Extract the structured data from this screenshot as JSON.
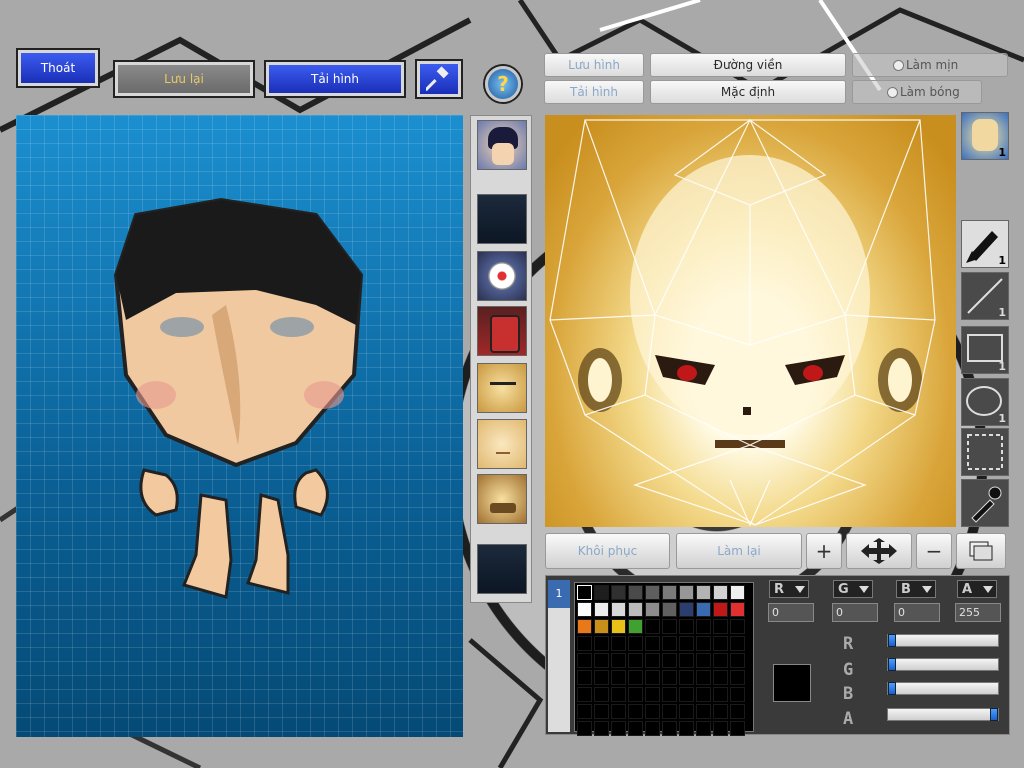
{
  "toolbar": {
    "exit_label": "Thoát",
    "save_label": "Lưu lại",
    "reload_label": "Tải hình",
    "help_icon": "question-mark-icon",
    "tool_icon": "hammer-icon"
  },
  "texture_tabs": {
    "save_image_label": "Lưu hình",
    "load_image_label": "Tải hình",
    "outline_label": "Đường viền",
    "default_label": "Mặc định",
    "smooth_label": "Làm mịn",
    "shine_label": "Làm bóng"
  },
  "parts": [
    {
      "name": "hair-part",
      "icon": "character-face-icon"
    },
    {
      "name": "empty-part",
      "icon": ""
    },
    {
      "name": "eye-part",
      "icon": "eyeball-icon"
    },
    {
      "name": "body-part",
      "icon": "armor-icon"
    },
    {
      "name": "face-angry-part",
      "icon": "face-icon"
    },
    {
      "name": "face-plain-part",
      "icon": "face-icon"
    },
    {
      "name": "face-beard-part",
      "icon": "face-icon"
    },
    {
      "name": "empty-part-2",
      "icon": ""
    }
  ],
  "tools": [
    {
      "name": "face-thumb",
      "count": "1"
    },
    {
      "name": "pen-tool",
      "count": "1"
    },
    {
      "name": "line-tool",
      "count": "1"
    },
    {
      "name": "rect-tool",
      "count": "1"
    },
    {
      "name": "ellipse-tool",
      "count": "1"
    },
    {
      "name": "select-tool",
      "count": ""
    },
    {
      "name": "eyedropper-tool",
      "count": ""
    }
  ],
  "edit_buttons": {
    "restore_label": "Khôi phục",
    "redo_label": "Làm lại"
  },
  "palette": {
    "page_number": "1",
    "colors": [
      "#000000",
      "#1e1e1e",
      "#303030",
      "#4a4a4a",
      "#5e5e5e",
      "#7a7a7a",
      "#979797",
      "#b4b4b4",
      "#d2d2d2",
      "#f0f0f0",
      "#ffffff",
      "#ececec",
      "#d8d8d8",
      "#bcbcbc",
      "#8d8d8d",
      "#606060",
      "#2c3e70",
      "#3a6ab0",
      "#c01818",
      "#e03030",
      "#e87818",
      "#c89018",
      "#e8c018",
      "#40a030"
    ],
    "current_color": "#000000"
  },
  "color_channels": {
    "r_label": "R",
    "g_label": "G",
    "b_label": "B",
    "a_label": "A",
    "r_value": "0",
    "g_value": "0",
    "b_value": "0",
    "a_value": "255"
  },
  "sliders": [
    {
      "label": "R",
      "value": 0
    },
    {
      "label": "G",
      "value": 0
    },
    {
      "label": "B",
      "value": 0
    },
    {
      "label": "A",
      "value": 255
    }
  ]
}
